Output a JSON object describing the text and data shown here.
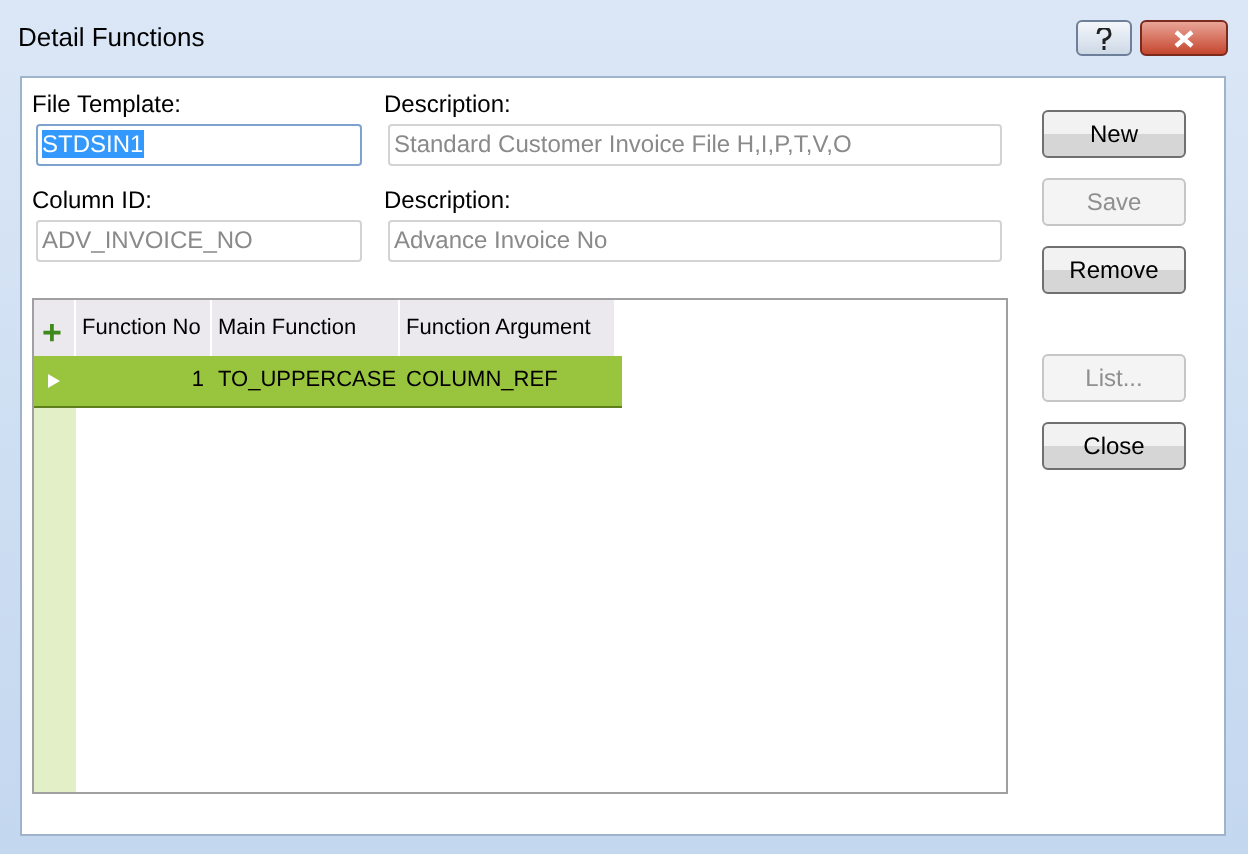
{
  "window": {
    "title": "Detail Functions"
  },
  "field_rows": [
    [
      {
        "label": "File Template:",
        "value": "STDSIN1",
        "disabled": false,
        "text_selected": true
      },
      {
        "label": "Description:",
        "value": "Standard Customer Invoice File H,I,P,T,V,O",
        "disabled": true,
        "text_selected": false
      }
    ],
    [
      {
        "label": "Column ID:",
        "value": "ADV_INVOICE_NO",
        "disabled": true,
        "text_selected": false
      },
      {
        "label": "Description:",
        "value": "Advance Invoice No",
        "disabled": true,
        "text_selected": false
      }
    ]
  ],
  "grid": {
    "add_symbol": "+",
    "columns": [
      "Function No",
      "Main Function",
      "Function Argument"
    ],
    "rows": [
      {
        "cells": [
          "1",
          "TO_UPPERCASE",
          "COLUMN_REF"
        ],
        "selected": true
      }
    ]
  },
  "buttons": [
    {
      "label": "New",
      "disabled": false
    },
    {
      "label": "Save",
      "disabled": true
    },
    {
      "label": "Remove",
      "disabled": false
    },
    {
      "label": "List...",
      "disabled": true
    },
    {
      "label": "Close",
      "disabled": false
    }
  ]
}
